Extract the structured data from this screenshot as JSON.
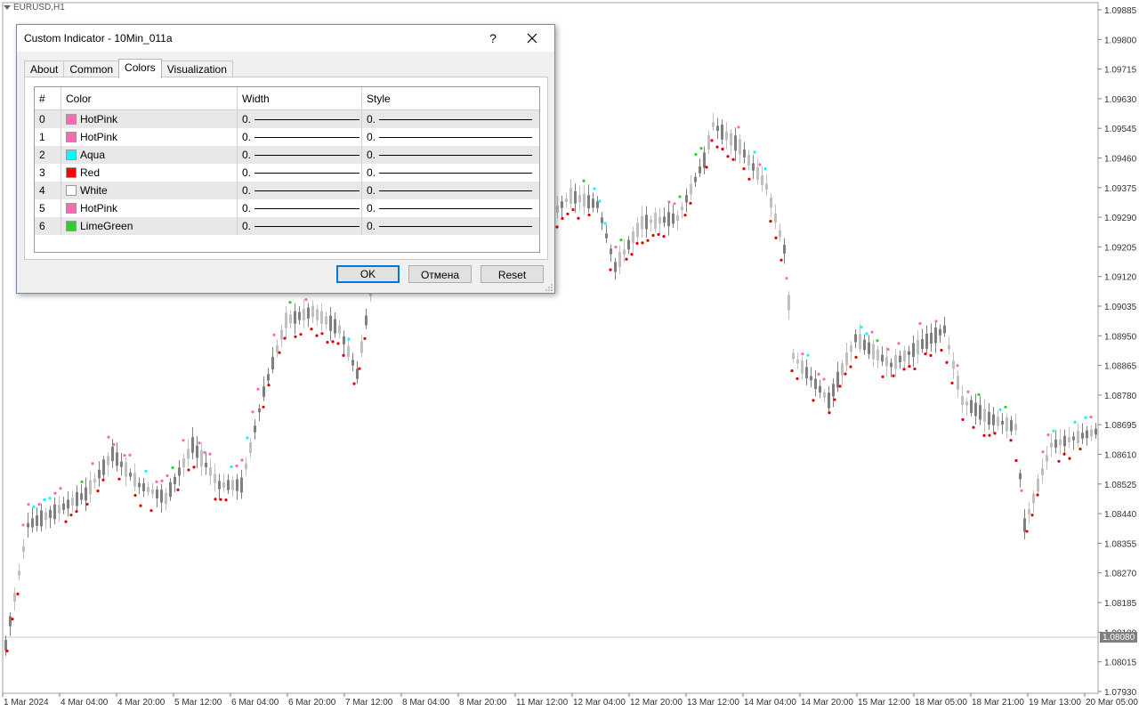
{
  "chart": {
    "symbol_label": "EURUSD,H1",
    "price_labels": [
      "1.09885",
      "1.09800",
      "1.09715",
      "1.09630",
      "1.09545",
      "1.09460",
      "1.09375",
      "1.09290",
      "1.09205",
      "1.09120",
      "1.09035",
      "1.08950",
      "1.08865",
      "1.08780",
      "1.08695",
      "1.08610",
      "1.08525",
      "1.08440",
      "1.08355",
      "1.08270",
      "1.08185",
      "1.08100",
      "1.08015",
      "1.07930"
    ],
    "current_price": "1.08080",
    "time_labels": [
      "1 Mar 2024",
      "4 Mar 04:00",
      "4 Mar 20:00",
      "5 Mar 12:00",
      "6 Mar 04:00",
      "6 Mar 20:00",
      "7 Mar 12:00",
      "8 Mar 04:00",
      "8 Mar 20:00",
      "11 Mar 12:00",
      "12 Mar 04:00",
      "12 Mar 20:00",
      "13 Mar 12:00",
      "14 Mar 04:00",
      "14 Mar 20:00",
      "15 Mar 12:00",
      "18 Mar 05:00",
      "18 Mar 21:00",
      "19 Mar 13:00",
      "20 Mar 05:00"
    ],
    "colors": {
      "bull": "#c0c0c0",
      "bear": "#7f7f7f",
      "red": "#e00000",
      "pink": "#ff69b4",
      "aqua": "#00ffff",
      "green": "#32cd32"
    }
  },
  "dialog": {
    "title": "Custom Indicator - 10Min_011a",
    "help_label": "?",
    "tabs": [
      {
        "label": "About"
      },
      {
        "label": "Common"
      },
      {
        "label": "Colors"
      },
      {
        "label": "Visualization"
      }
    ],
    "table": {
      "headers": {
        "index": "#",
        "color": "Color",
        "width": "Width",
        "style": "Style"
      },
      "rows": [
        {
          "index": "0",
          "color_name": "HotPink",
          "color_hex": "#ff69b4",
          "width": "0.",
          "style": "0."
        },
        {
          "index": "1",
          "color_name": "HotPink",
          "color_hex": "#ff69b4",
          "width": "0.",
          "style": "0."
        },
        {
          "index": "2",
          "color_name": "Aqua",
          "color_hex": "#00ffff",
          "width": "0.",
          "style": "0."
        },
        {
          "index": "3",
          "color_name": "Red",
          "color_hex": "#ff0000",
          "width": "0.",
          "style": "0."
        },
        {
          "index": "4",
          "color_name": "White",
          "color_hex": "#ffffff",
          "width": "0.",
          "style": "0."
        },
        {
          "index": "5",
          "color_name": "HotPink",
          "color_hex": "#ff69b4",
          "width": "0.",
          "style": "0."
        },
        {
          "index": "6",
          "color_name": "LimeGreen",
          "color_hex": "#32cd32",
          "width": "0.",
          "style": "0."
        }
      ]
    },
    "buttons": {
      "ok": "OK",
      "cancel": "Отмена",
      "reset": "Reset"
    }
  }
}
